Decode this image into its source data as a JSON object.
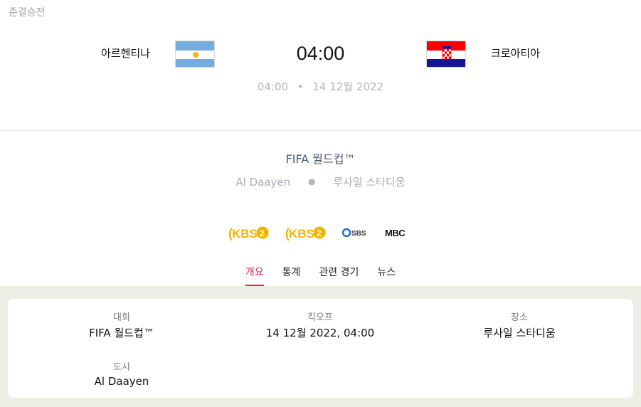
{
  "match": {
    "stage": "준결승전",
    "home_team": "아르헨티나",
    "away_team": "크로아티아",
    "score": "04:00",
    "kickoff_time": "04:00",
    "separator": "•",
    "kickoff_date": "14 12월 2022",
    "competition": "FIFA 월드컵™",
    "city": "Al Daayen",
    "venue_separator": "●",
    "stadium": "루사일 스타디움"
  },
  "broadcasters": [
    {
      "name": "KBS2",
      "icon": "kbs2-logo",
      "color": "#f2b400"
    },
    {
      "name": "KBS2",
      "icon": "kbs2-logo",
      "color": "#f2b400"
    },
    {
      "name": "SBS",
      "icon": "sbs-logo",
      "color": "#1c6fc8"
    },
    {
      "name": "MBC",
      "icon": "mbc-logo",
      "color": "#111111"
    }
  ],
  "tabs": [
    {
      "label": "개요",
      "active": true
    },
    {
      "label": "통계",
      "active": false
    },
    {
      "label": "관련 경기",
      "active": false
    },
    {
      "label": "뉴스",
      "active": false
    }
  ],
  "details": {
    "competition_label": "대회",
    "competition_value": "FIFA 월드컵™",
    "kickoff_label": "킥오프",
    "kickoff_value": "14 12월 2022, 04:00",
    "venue_label": "장소",
    "venue_value": "루사일 스타디움",
    "city_label": "도시",
    "city_value": "Al Daayen"
  },
  "colors": {
    "accent": "#e0245e",
    "panel_background": "#efeee6",
    "argentina_blue": "#74acdf",
    "croatia_red": "#ff0000",
    "croatia_blue": "#171796"
  }
}
